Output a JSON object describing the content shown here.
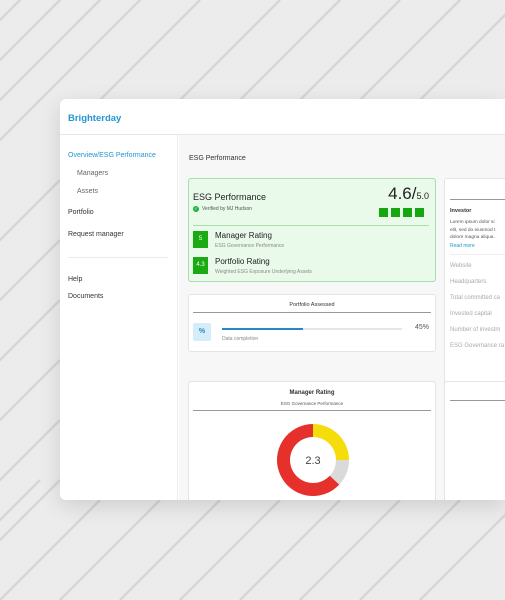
{
  "app": {
    "brand": "Brighterday"
  },
  "sidebar": {
    "items": [
      {
        "label": "Overview/ESG Performance"
      },
      {
        "label": "Managers"
      },
      {
        "label": "Assets"
      },
      {
        "label": "Portfolio"
      },
      {
        "label": "Request manager"
      },
      {
        "label": "Help"
      },
      {
        "label": "Documents"
      }
    ]
  },
  "page": {
    "title": "ESG Performance"
  },
  "esg_card": {
    "title": "ESG Performance",
    "verified": "Verified by MJ Hudson",
    "score": "4.6/",
    "score_max": "5.0",
    "rating_level": 4,
    "ratings": [
      {
        "value": "5",
        "title": "Manager Rating",
        "subtitle": "ESG Governance Performance"
      },
      {
        "value": "4.3",
        "title": "Portfolio Rating",
        "subtitle": "Weighted ESG Exposure Underlying Assets"
      }
    ]
  },
  "portfolio_assessed": {
    "title": "Portfolio Assessed",
    "icon": "%",
    "progress": 0.45,
    "progress_label": "45%",
    "caption": "Data completion"
  },
  "investor": {
    "title": "Investor",
    "lorem": [
      "Lorem ipsum dolor si",
      "elit, sed do eiusmod t",
      "dolore magna aliqua."
    ],
    "read_more": "Read more",
    "fields": [
      "Website",
      "Headquarters",
      "Total committed ca",
      "Invested capital",
      "Number of investm",
      "ESG Governance ra"
    ]
  },
  "manager_rating": {
    "title": "Manager Rating",
    "subtitle": "ESG Governance Performance",
    "value": "2.3",
    "donut_segments": [
      {
        "color": "#f4dd0a",
        "fraction": 0.25
      },
      {
        "color": "#dadada",
        "fraction": 0.12
      },
      {
        "color": "#e6302b",
        "fraction": 0.63
      }
    ]
  },
  "colors": {
    "accent": "#2196d3",
    "green": "#16a60f",
    "progress": "#2a85c6",
    "red": "#e6302b",
    "yellow": "#f4dd0a"
  }
}
